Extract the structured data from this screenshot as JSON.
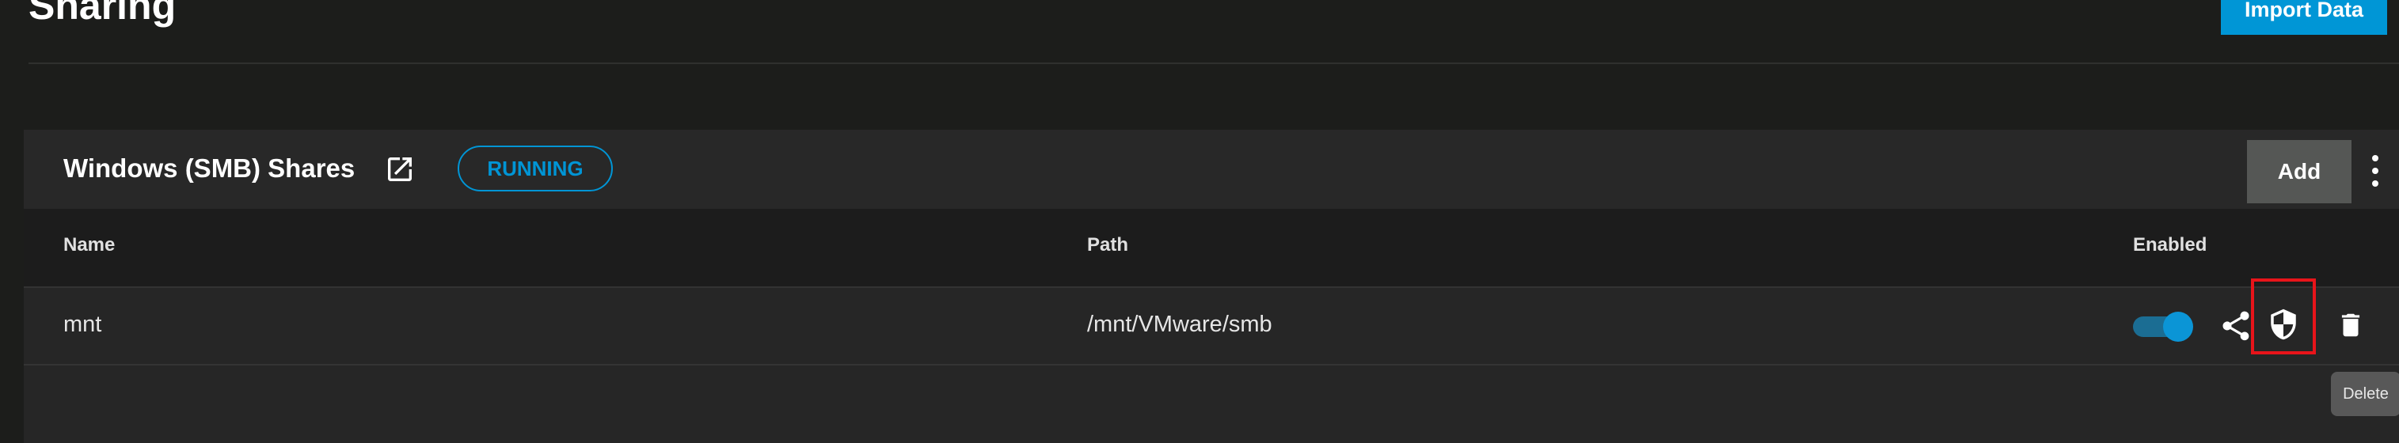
{
  "page": {
    "title": "Sharing",
    "import_button": "Import Data"
  },
  "smb_card": {
    "title": "Windows (SMB) Shares",
    "status": "RUNNING",
    "add_button": "Add",
    "columns": [
      "Name",
      "Path",
      "Enabled"
    ],
    "rows": [
      {
        "name": "mnt",
        "path": "/mnt/VMware/smb",
        "enabled": true
      }
    ]
  },
  "tooltip": {
    "text": "Delete"
  },
  "colors": {
    "accent": "#0095d5",
    "highlight_border": "#e8141a"
  }
}
